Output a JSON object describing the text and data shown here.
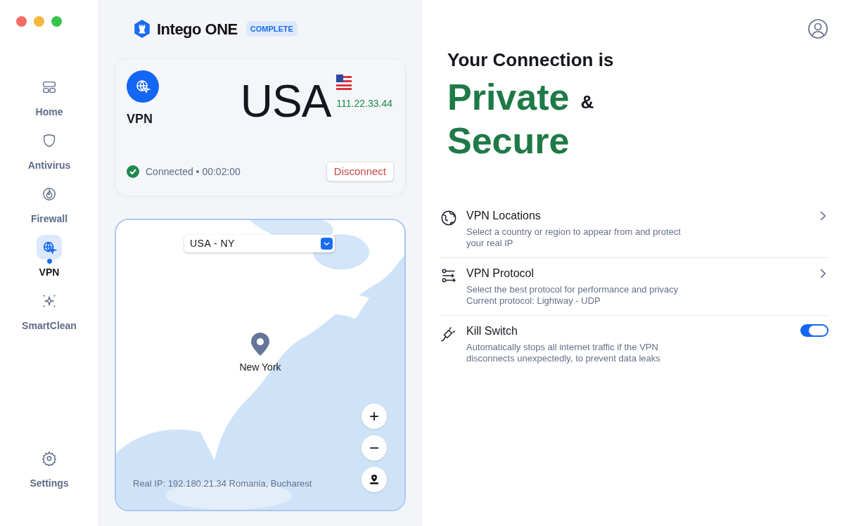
{
  "sidebar": {
    "items": [
      {
        "label": "Home",
        "selected": false
      },
      {
        "label": "Antivirus",
        "selected": false
      },
      {
        "label": "Firewall",
        "selected": false
      },
      {
        "label": "VPN",
        "selected": true
      },
      {
        "label": "SmartClean",
        "selected": false
      }
    ],
    "footer_item": {
      "label": "Settings",
      "selected": false
    }
  },
  "brand": {
    "name": "Intego ONE",
    "badge": "COMPLETE"
  },
  "vpn_card": {
    "label": "VPN",
    "country": "USA",
    "ip": "111.22.33.44",
    "status": "Connected",
    "separator": "•",
    "duration": "00:02:00",
    "connected": true,
    "disconnect_button": "Disconnect"
  },
  "map": {
    "location_select": "USA - NY",
    "marker_label": "New York",
    "real_ip": "Real IP: 192.180.21.34 Romania, Bucharest",
    "controls": [
      "+",
      "−"
    ]
  },
  "headline": {
    "line1": "Your Connection is",
    "word1": "Private",
    "amp": "&",
    "word2": "Secure"
  },
  "settings": [
    {
      "kind": "link",
      "title": "VPN Locations",
      "description": "Select a country or region to appear from and protect your real IP"
    },
    {
      "kind": "link",
      "title": "VPN Protocol",
      "description": "Select the best protocol for performance and privacy",
      "detail": "Current protocol: Lightway - UDP"
    },
    {
      "kind": "toggle",
      "title": "Kill Switch",
      "description": "Automatically stops all internet traffic if the VPN disconnects unexpectedly, to prevent data leaks",
      "on": true
    }
  ]
}
